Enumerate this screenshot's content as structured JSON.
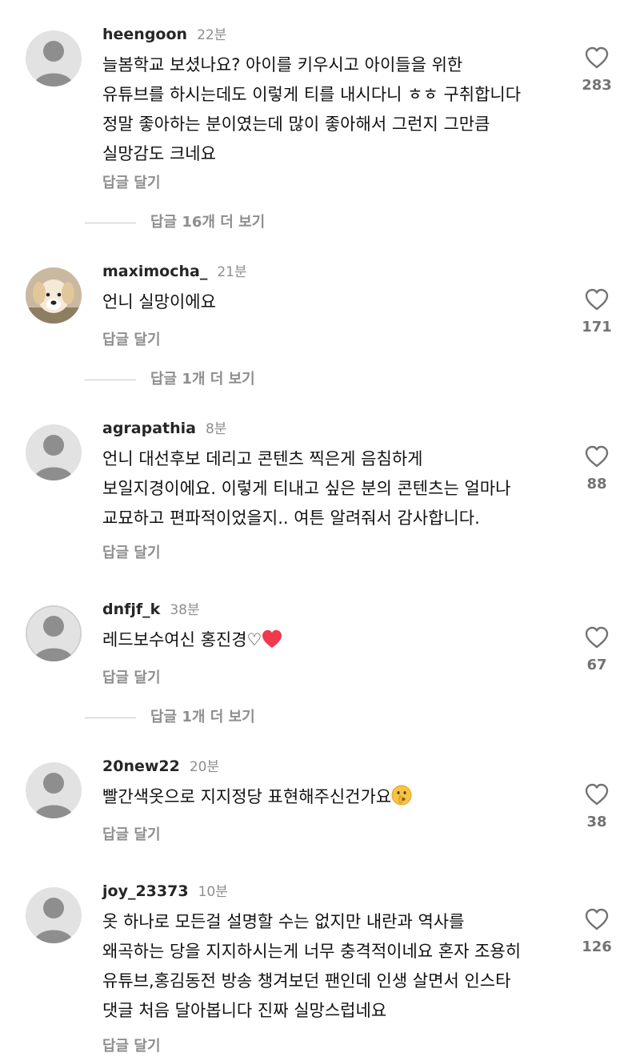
{
  "comments": [
    {
      "username": "heengoon",
      "time": "22분",
      "lines": [
        "늘봄학교 보셨나요? 아이를 키우시고 아이들을 위한",
        "유튜브를 하시는데도 이렇게 티를 내시다니 ㅎㅎ 구취합니다",
        "정말 좋아하는 분이였는데 많이 좋아해서 그런지 그만큼",
        "실망감도 크네요"
      ],
      "reply_label": "답글 달기",
      "likes": "283",
      "view_replies": "답글 16개 더 보기"
    },
    {
      "username": "maximocha_",
      "time": "21분",
      "lines": [
        "언니 실망이에요"
      ],
      "reply_label": "답글 달기",
      "likes": "171",
      "view_replies": "답글 1개 더 보기"
    },
    {
      "username": "agrapathia",
      "time": "8분",
      "lines": [
        "언니 대선후보 데리고 콘텐츠 찍은게 음침하게",
        "보일지경이에요. 이렇게 티내고 싶은 분의 콘텐츠는 얼마나",
        "교묘하고 편파적이었을지.. 여튼 알려줘서 감사합니다."
      ],
      "reply_label": "답글 달기",
      "likes": "88"
    },
    {
      "username": "dnfjf_k",
      "time": "38분",
      "lines": [
        "레드보수여신 홍진경♡"
      ],
      "reply_label": "답글 달기",
      "likes": "67",
      "view_replies": "답글 1개 더 보기"
    },
    {
      "username": "20new22",
      "time": "20분",
      "lines": [
        "빨간색옷으로 지지정당 표현해주신건가요"
      ],
      "reply_label": "답글 달기",
      "likes": "38"
    },
    {
      "username": "joy_23373",
      "time": "10분",
      "lines": [
        "옷 하나로 모든걸 설명할 수는 없지만 내란과 역사를",
        "왜곡하는 당을 지지하시는게 너무 충격적이네요 혼자 조용히",
        "유튜브,홍김동전 방송 챙겨보던 팬인데 인생 살면서 인스타",
        "댓글 처음 달아봅니다 진짜 실망스럽네요"
      ],
      "reply_label": "답글 달기",
      "likes": "126"
    }
  ],
  "icons": {
    "heart": "heart-outline-icon",
    "default_avatar": "default-avatar-icon",
    "emoji_heart": "red-heart-emoji",
    "emoji_face": "shushing-face-emoji"
  },
  "colors": {
    "meta_gray": "#8e8e8e",
    "count_gray": "#737373",
    "emoji_heart": "#f0384f",
    "emoji_face": "#f6c445"
  }
}
